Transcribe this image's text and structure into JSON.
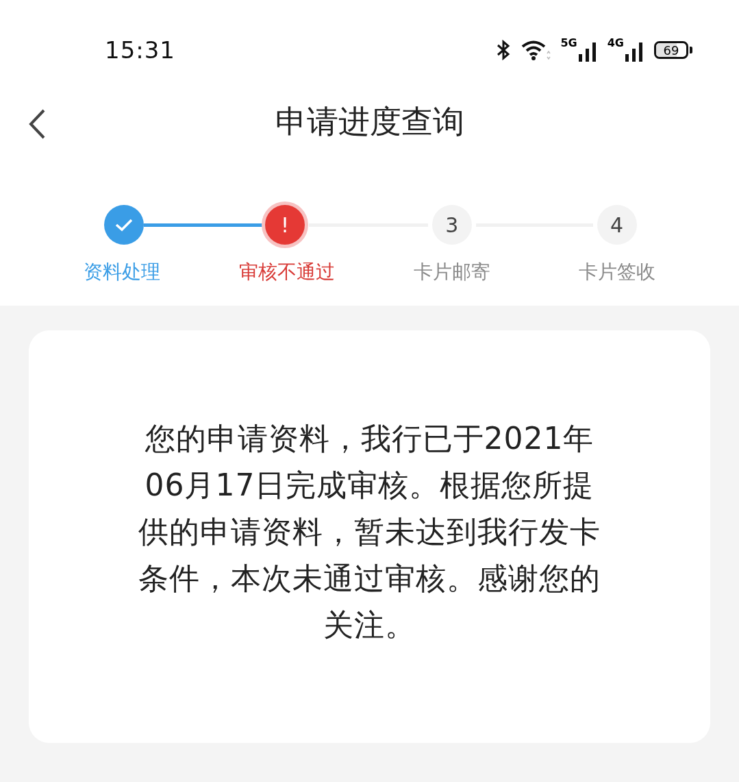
{
  "status_bar": {
    "time": "15:31",
    "network_5g": "5G",
    "network_4g": "4G",
    "battery": "69"
  },
  "header": {
    "title": "申请进度查询"
  },
  "steps": [
    {
      "label": "资料处理",
      "kind": "done"
    },
    {
      "label": "审核不通过",
      "kind": "failed",
      "marker": "!"
    },
    {
      "label": "卡片邮寄",
      "kind": "pending",
      "marker": "3"
    },
    {
      "label": "卡片签收",
      "kind": "pending",
      "marker": "4"
    }
  ],
  "message": "您的申请资料，我行已于2021年06月17日完成审核。根据您所提供的申请资料，暂未达到我行发卡条件，本次未通过审核。感谢您的关注。"
}
